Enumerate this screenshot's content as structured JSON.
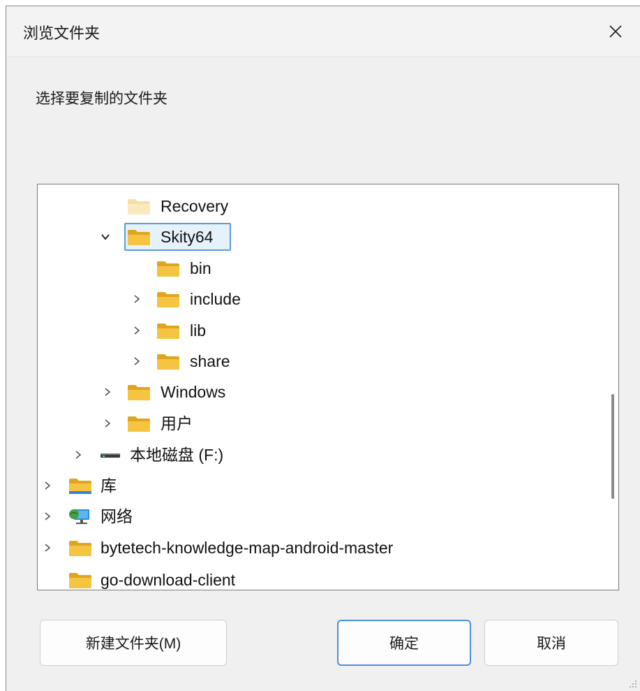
{
  "dialog": {
    "title": "浏览文件夹",
    "instruction": "选择要复制的文件夹"
  },
  "tree": {
    "items": [
      {
        "label": "Recovery",
        "expander": "none",
        "icon": "folder-light-icon"
      },
      {
        "label": "Skity64",
        "expander": "expanded",
        "icon": "folder-icon",
        "selected": true
      },
      {
        "label": "bin",
        "expander": "none",
        "icon": "folder-icon"
      },
      {
        "label": "include",
        "expander": "collapsed",
        "icon": "folder-icon"
      },
      {
        "label": "lib",
        "expander": "collapsed",
        "icon": "folder-icon"
      },
      {
        "label": "share",
        "expander": "collapsed",
        "icon": "folder-icon"
      },
      {
        "label": "Windows",
        "expander": "collapsed",
        "icon": "folder-icon"
      },
      {
        "label": "用户",
        "expander": "collapsed",
        "icon": "folder-icon"
      },
      {
        "label": "本地磁盘 (F:)",
        "expander": "collapsed",
        "icon": "drive-icon"
      },
      {
        "label": "库",
        "expander": "collapsed",
        "icon": "library-icon"
      },
      {
        "label": "网络",
        "expander": "collapsed",
        "icon": "network-icon"
      },
      {
        "label": "bytetech-knowledge-map-android-master",
        "expander": "collapsed",
        "icon": "folder-icon"
      },
      {
        "label": "go-download-client",
        "expander": "none",
        "icon": "folder-icon"
      }
    ]
  },
  "buttons": {
    "new_folder": "新建文件夹(M)",
    "ok": "确定",
    "cancel": "取消"
  },
  "colors": {
    "selection_border": "#5b9bd5",
    "folder_yellow": "#f5c542",
    "primary_border": "#4a90d9"
  }
}
